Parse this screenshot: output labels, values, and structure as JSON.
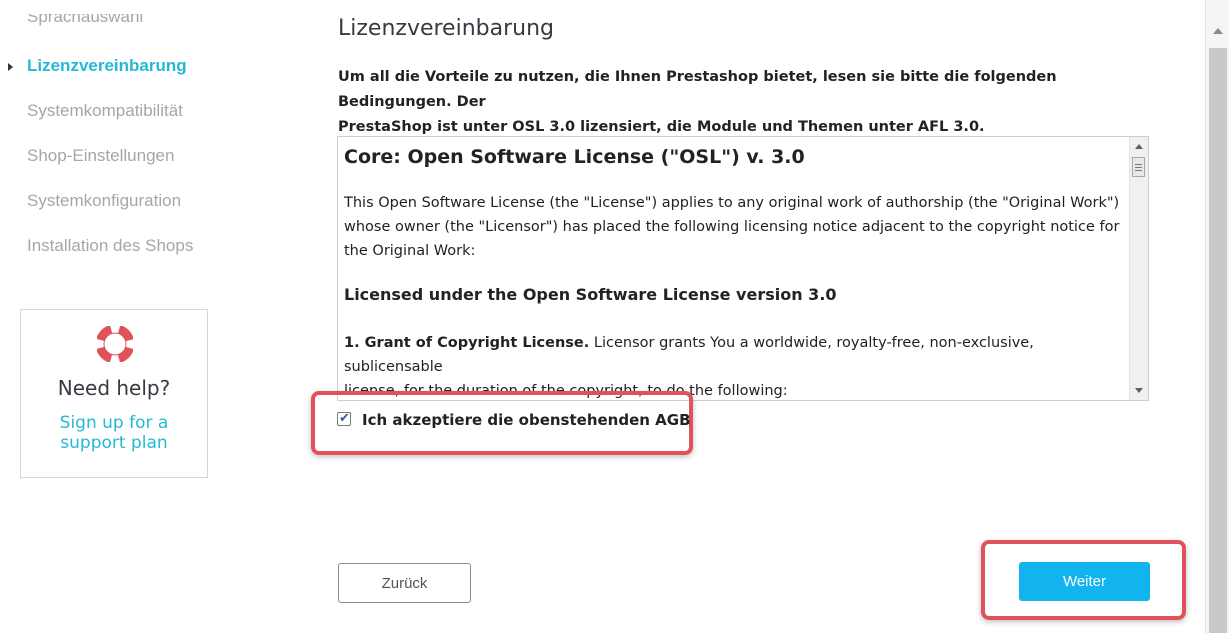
{
  "sidebar": {
    "steps": [
      {
        "label": "Sprachauswahl"
      },
      {
        "label": "Lizenzvereinbarung"
      },
      {
        "label": "Systemkompatibilität"
      },
      {
        "label": "Shop-Einstellungen"
      },
      {
        "label": "Systemkonfiguration"
      },
      {
        "label": "Installation des Shops"
      }
    ],
    "active_step": "Lizenzvereinbarung",
    "help": {
      "icon": "lifebuoy-icon",
      "title": "Need help?",
      "link_line1": "Sign up for a",
      "link_line2": "support plan"
    }
  },
  "main": {
    "title": "Lizenzvereinbarung",
    "intro_line1": "Um all die Vorteile zu nutzen, die Ihnen Prestashop bietet, lesen sie bitte die folgenden Bedingungen. Der",
    "intro_line2": "PrestaShop ist unter OSL 3.0 lizensiert, die Module und Themen unter AFL 3.0.",
    "license": {
      "heading": "Core: Open Software License (\"OSL\") v. 3.0",
      "para1_line1": "This Open Software License (the \"License\") applies to any original work of authorship (the \"Original Work\")",
      "para1_line2": "whose owner (the \"Licensor\") has placed the following licensing notice adjacent to the copyright notice for",
      "para1_line3": "the Original Work:",
      "subheading": "Licensed under the Open Software License version 3.0",
      "para2_bold": "1. Grant of Copyright License.",
      "para2_rest": " Licensor grants You a worldwide, royalty-free, non-exclusive, sublicensable",
      "para2_line2": "license, for the duration of the copyright, to do the following:"
    },
    "accept": {
      "label": "Ich akzeptiere die obenstehenden AGB",
      "checked": true
    },
    "buttons": {
      "back": "Zurück",
      "next": "Weiter"
    }
  },
  "colors": {
    "accent": "#25b9d7",
    "primary_button": "#12b4ef",
    "highlight": "#e0525a"
  }
}
